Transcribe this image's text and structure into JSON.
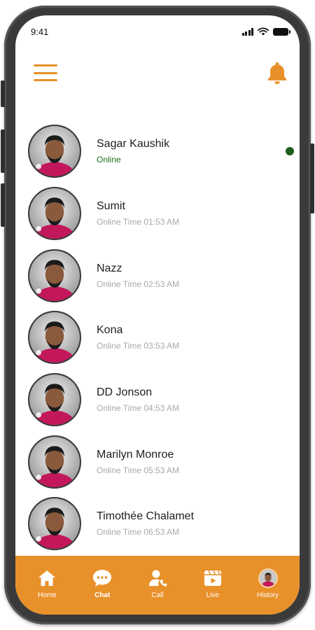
{
  "status_bar": {
    "time": "9:41"
  },
  "header": {
    "menu_icon": "hamburger-menu-icon",
    "bell_icon": "bell-icon"
  },
  "contacts": [
    {
      "name": "Sagar Kaushik",
      "status": "Online",
      "online": true
    },
    {
      "name": "Sumit",
      "status": "Online Time 01:53 AM",
      "online": false
    },
    {
      "name": "Nazz",
      "status": "Online Time 02:53 AM",
      "online": false
    },
    {
      "name": "Kona",
      "status": "Online Time 03:53 AM",
      "online": false
    },
    {
      "name": "DD Jonson",
      "status": "Online Time 04:53 AM",
      "online": false
    },
    {
      "name": "Marilyn Monroe",
      "status": "Online Time 05:53 AM",
      "online": false
    },
    {
      "name": "Timothée Chalamet",
      "status": "Online Time 06:53 AM",
      "online": false
    }
  ],
  "bottom_nav": [
    {
      "label": "Home",
      "icon": "home-icon",
      "active": false
    },
    {
      "label": "Chat",
      "icon": "chat-icon",
      "active": true
    },
    {
      "label": "Call",
      "icon": "call-icon",
      "active": false
    },
    {
      "label": "Live",
      "icon": "live-icon",
      "active": false
    },
    {
      "label": "History",
      "icon": "history-avatar-icon",
      "active": false
    }
  ],
  "colors": {
    "accent": "#E8912A",
    "online_text": "#1b6e1b",
    "online_dot": "#1f5d1f",
    "muted_text": "#a8a8a8",
    "frame": "#3a3a3a"
  }
}
